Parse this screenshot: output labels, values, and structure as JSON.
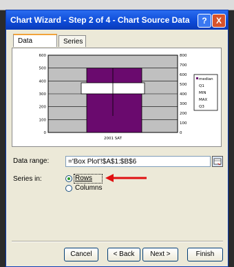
{
  "window": {
    "title": "Chart Wizard - Step 2 of 4 - Chart Source Data",
    "help_label": "?",
    "close_label": "X"
  },
  "tabs": [
    {
      "label": "Data Range",
      "active": true
    },
    {
      "label": "Series",
      "active": false
    }
  ],
  "preview": {
    "left_axis_ticks": [
      "600",
      "500",
      "400",
      "300",
      "200",
      "100",
      "0"
    ],
    "right_axis_ticks": [
      "800",
      "700",
      "600",
      "500",
      "400",
      "300",
      "200",
      "100",
      "0"
    ],
    "category_label": "2001 SAT",
    "legend": [
      "median",
      "Q1",
      "MIN",
      "MAX",
      "Q3"
    ]
  },
  "data_range": {
    "label": "Data range:",
    "value": "='Box Plot'!$A$1:$B$6"
  },
  "series_in": {
    "label": "Series in:",
    "options": [
      {
        "label": "Rows",
        "selected": true
      },
      {
        "label": "Columns",
        "selected": false
      }
    ]
  },
  "buttons": {
    "cancel": "Cancel",
    "back": "< Back",
    "next": "Next >",
    "finish": "Finish"
  },
  "colors": {
    "title_bar": "#0d4ad6",
    "bar_fill": "#6a0a6e",
    "annotation_arrow": "#e01010"
  }
}
